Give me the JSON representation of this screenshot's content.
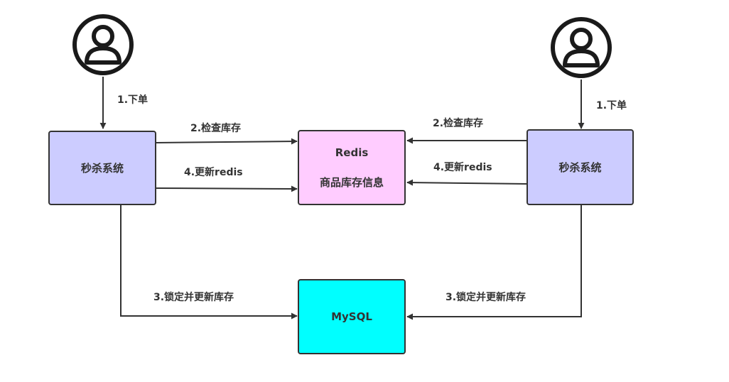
{
  "colors": {
    "system_box": "#ccccff",
    "redis_box": "#ffccff",
    "mysql_box": "#00ffff",
    "stroke": "#333333"
  },
  "icons": {
    "user_left": "user-avatar-icon",
    "user_right": "user-avatar-icon"
  },
  "nodes": {
    "system_left": "秒杀系统",
    "system_right": "秒杀系统",
    "redis_title": "Redis",
    "redis_subtitle": "商品库存信息",
    "mysql": "MySQL"
  },
  "edges": {
    "left_order": "1.下单",
    "right_order": "1.下单",
    "left_check": "2.检查库存",
    "right_check": "2.检查库存",
    "left_update_redis": "4.更新redis",
    "right_update_redis": "4.更新redis",
    "left_lock_mysql": "3.锁定并更新库存",
    "right_lock_mysql": "3.锁定并更新库存"
  }
}
